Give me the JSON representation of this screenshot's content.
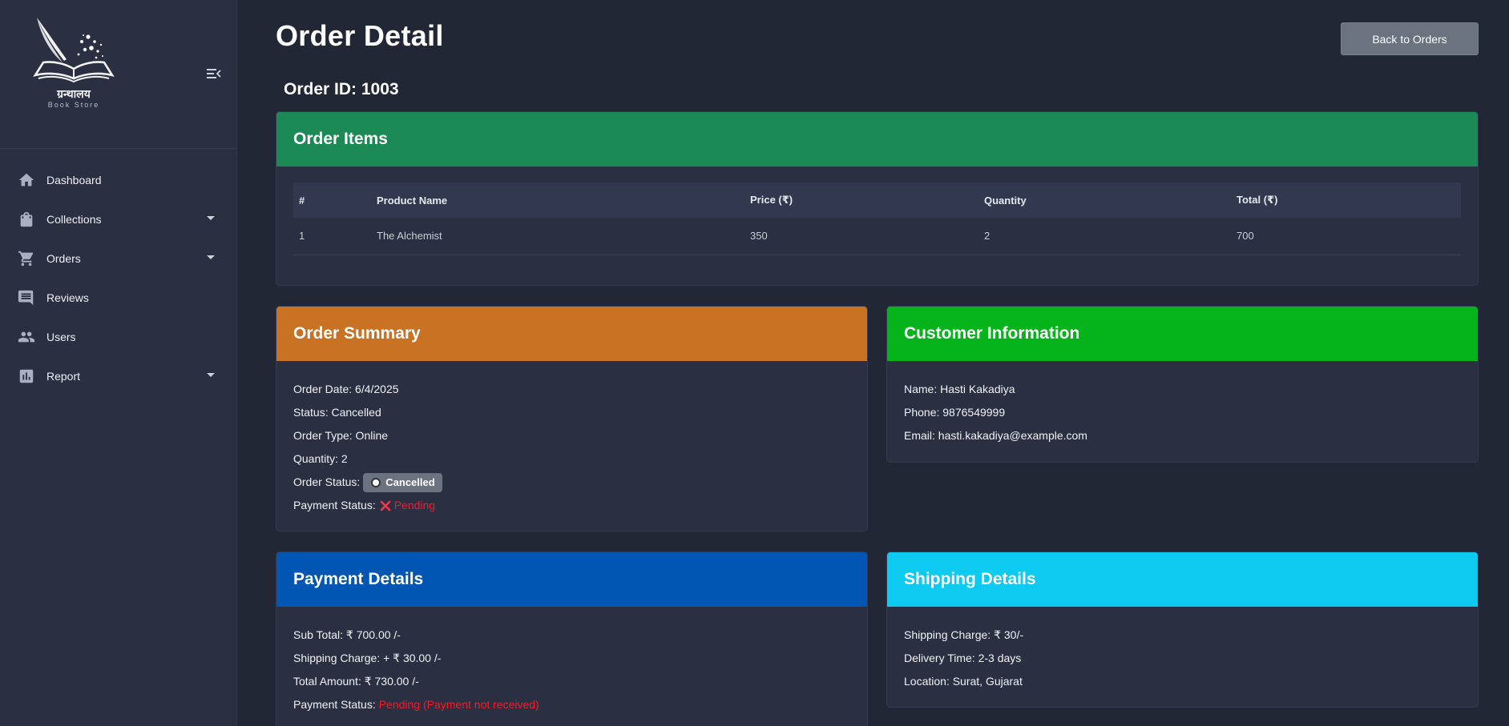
{
  "brand": {
    "title": "ग्रन्थालय",
    "subtitle": "Book Store"
  },
  "sidebar": {
    "items": [
      {
        "label": "Dashboard",
        "icon": "home-icon",
        "has_caret": false
      },
      {
        "label": "Collections",
        "icon": "shopping-bag-icon",
        "has_caret": true
      },
      {
        "label": "Orders",
        "icon": "cart-icon",
        "has_caret": true
      },
      {
        "label": "Reviews",
        "icon": "comment-icon",
        "has_caret": false
      },
      {
        "label": "Users",
        "icon": "users-icon",
        "has_caret": false
      },
      {
        "label": "Report",
        "icon": "chart-icon",
        "has_caret": true
      }
    ]
  },
  "page": {
    "title": "Order Detail",
    "back_label": "Back to Orders",
    "order_id": "Order ID: 1003"
  },
  "order_items": {
    "title": "Order Items",
    "columns": [
      "#",
      "Product Name",
      "Price (₹)",
      "Quantity",
      "Total (₹)"
    ],
    "rows": [
      [
        "1",
        "The Alchemist",
        "350",
        "2",
        "700"
      ]
    ]
  },
  "summary": {
    "title": "Order Summary",
    "order_date": "Order Date: 6/4/2025",
    "status": "Status: Cancelled",
    "order_type": "Order Type: Online",
    "quantity": "Quantity: 2",
    "order_status_label": "Order Status:",
    "order_status_badge": "Cancelled",
    "payment_status_label": "Payment Status:",
    "payment_status_value": "Pending"
  },
  "customer": {
    "title": "Customer Information",
    "name": "Name: Hasti Kakadiya",
    "phone": "Phone: 9876549999",
    "email": "Email: hasti.kakadiya@example.com"
  },
  "payment": {
    "title": "Payment Details",
    "sub_total": "Sub Total: ₹ 700.00 /-",
    "shipping_charge": "Shipping Charge: + ₹ 30.00 /-",
    "total_amount": "Total Amount: ₹ 730.00 /-",
    "payment_status_label": "Payment Status:",
    "payment_status_value": "Pending (Payment not received)"
  },
  "shipping": {
    "title": "Shipping Details",
    "charge": "Shipping Charge: ₹ 30/-",
    "delivery_time": "Delivery Time: 2-3 days",
    "location": "Location: Surat, Gujarat"
  },
  "colors": {
    "items_header": "#1c8a54",
    "summary_header": "#c97224",
    "customer_header": "#05b41a",
    "payment_header": "#0256b3",
    "shipping_header": "#0dcaf0",
    "danger": "#f11a2a"
  }
}
